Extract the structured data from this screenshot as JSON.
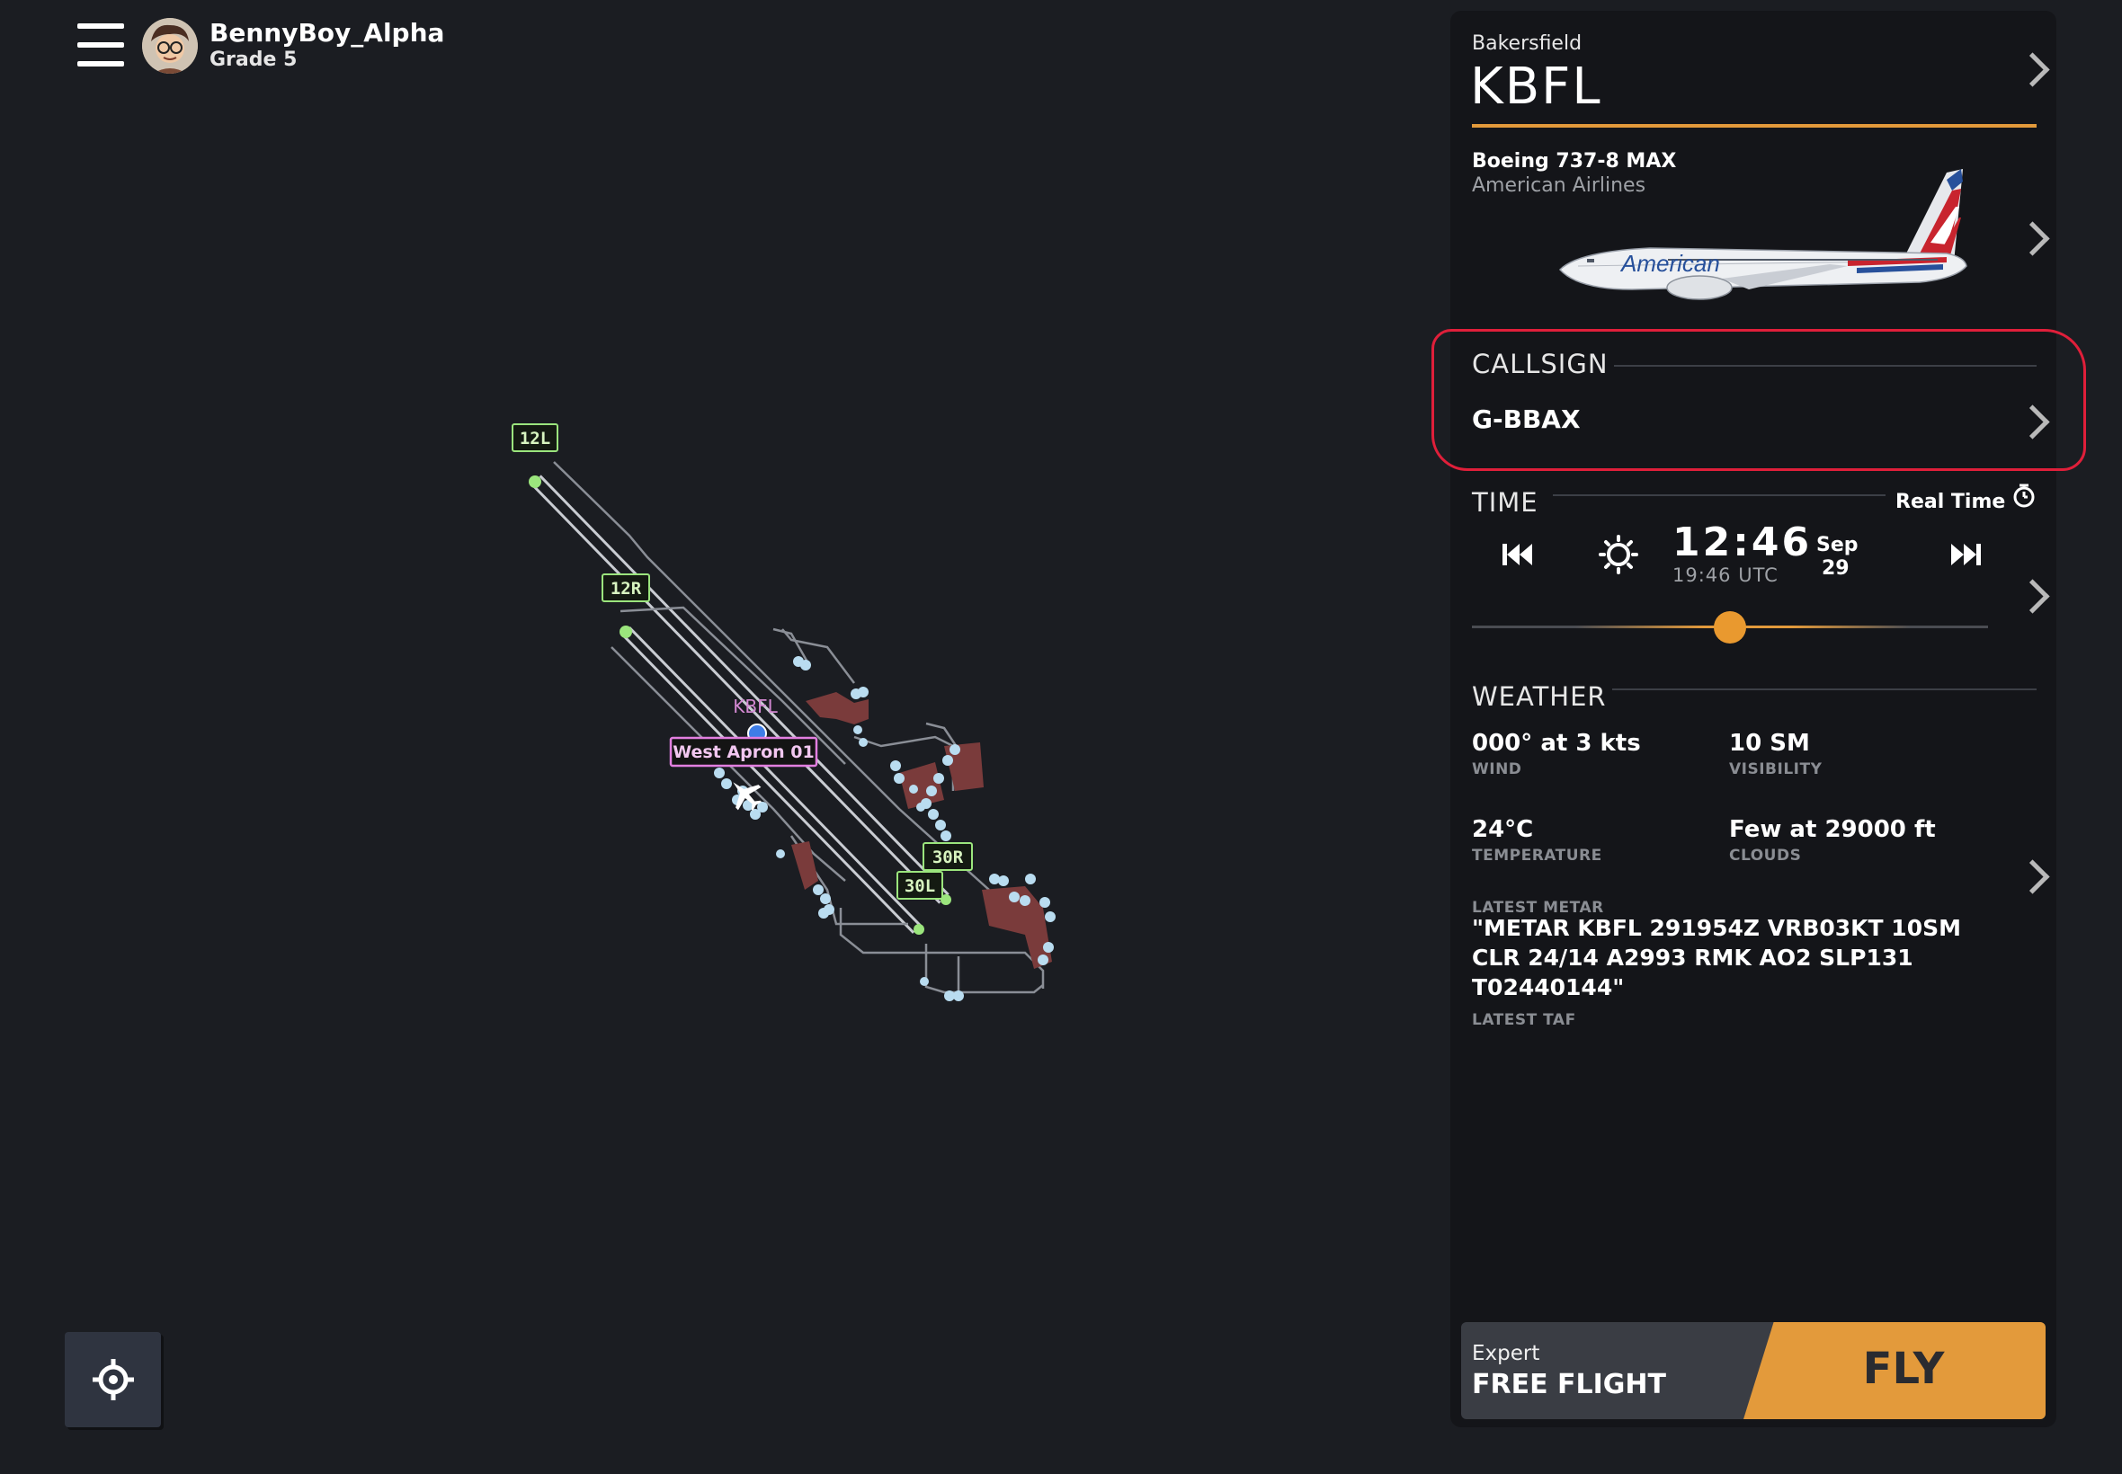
{
  "user": {
    "name": "BennyBoy_Alpha",
    "grade": "Grade 5"
  },
  "map": {
    "runway_labels": [
      "12L",
      "12R",
      "30R",
      "30L"
    ],
    "airport_label": "KBFL",
    "stand_label": "West Apron 01"
  },
  "airport": {
    "city": "Bakersfield",
    "icao": "KBFL"
  },
  "aircraft": {
    "type": "Boeing 737-8 MAX",
    "airline": "American Airlines",
    "livery_text": "American"
  },
  "callsign": {
    "title": "CALLSIGN",
    "value": "G-BBAX"
  },
  "time": {
    "title": "TIME",
    "mode": "Real Time",
    "local": "12:46",
    "utc": "19:46 UTC",
    "month": "Sep",
    "day": "29",
    "slider_fraction": 0.5
  },
  "weather": {
    "title": "WEATHER",
    "wind_value": "000° at 3 kts",
    "wind_label": "WIND",
    "visibility_value": "10 SM",
    "visibility_label": "VISIBILITY",
    "temperature_value": "24°C",
    "temperature_label": "TEMPERATURE",
    "clouds_value": "Few at 29000 ft",
    "clouds_label": "CLOUDS",
    "metar_label": "LATEST METAR",
    "metar_value": "\"METAR KBFL 291954Z VRB03KT 10SM CLR 24/14 A2993 RMK AO2 SLP131 T02440144\"",
    "taf_label": "LATEST TAF"
  },
  "flight": {
    "mode": "Expert",
    "type": "FREE FLIGHT",
    "fly_label": "FLY"
  },
  "colors": {
    "accent": "#e39a3b",
    "highlight": "#e01f3a",
    "runway_marker": "#9be57d",
    "stand": "#e27fe0"
  },
  "icons": [
    "menu-icon",
    "avatar",
    "chevron-right-icon",
    "skip-back-icon",
    "sun-icon",
    "skip-forward-icon",
    "clock-settings-icon",
    "recenter-icon",
    "aircraft-icon"
  ]
}
